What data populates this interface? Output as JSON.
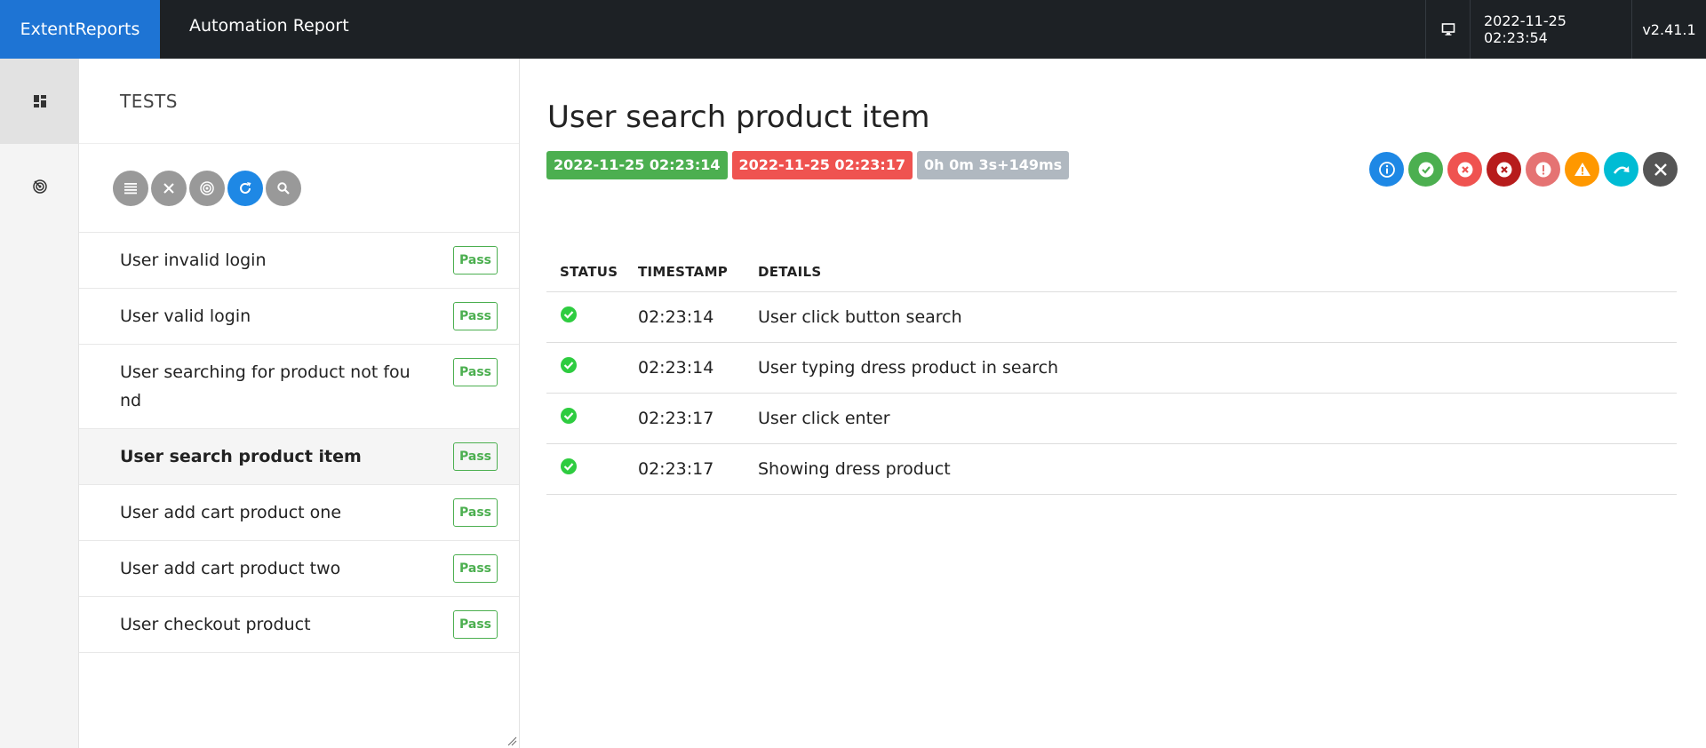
{
  "header": {
    "brand": "ExtentReports",
    "title": "Automation Report",
    "datetime": "2022-11-25 02:23:54",
    "version": "v2.41.1"
  },
  "colors": {
    "brand_blue": "#1e74d4",
    "topbar": "#1d2125",
    "pass_green": "#4caf50",
    "fail_red": "#ef5350",
    "duration_gray": "#b0b8c0"
  },
  "rail": {
    "items": [
      {
        "icon": "dashboard-icon",
        "active": true
      },
      {
        "icon": "radar-icon",
        "active": false
      }
    ]
  },
  "tests_panel": {
    "heading": "TESTS",
    "toolbar": [
      "list-icon",
      "close-icon",
      "radar-icon",
      "refresh-icon",
      "search-icon"
    ],
    "items": [
      {
        "name": "User invalid login",
        "status": "Pass"
      },
      {
        "name": "User valid login",
        "status": "Pass"
      },
      {
        "name": "User searching for product not found",
        "status": "Pass"
      },
      {
        "name": "User search product item",
        "status": "Pass"
      },
      {
        "name": "User add cart product one",
        "status": "Pass"
      },
      {
        "name": "User add cart product two",
        "status": "Pass"
      },
      {
        "name": "User checkout product",
        "status": "Pass"
      }
    ]
  },
  "detail": {
    "title": "User search product item",
    "start_time": "2022-11-25 02:23:14",
    "end_time": "2022-11-25 02:23:17",
    "duration": "0h 0m 3s+149ms",
    "status_filters": [
      "info-icon",
      "pass-icon",
      "fail-icon",
      "fatal-icon",
      "error-icon",
      "warning-icon",
      "skip-icon",
      "clear-icon"
    ],
    "columns": [
      "STATUS",
      "TIMESTAMP",
      "DETAILS"
    ],
    "steps": [
      {
        "status": "pass",
        "timestamp": "02:23:14",
        "details": "User click button search"
      },
      {
        "status": "pass",
        "timestamp": "02:23:14",
        "details": "User typing dress product in search"
      },
      {
        "status": "pass",
        "timestamp": "02:23:17",
        "details": "User click enter"
      },
      {
        "status": "pass",
        "timestamp": "02:23:17",
        "details": "Showing dress product"
      }
    ]
  }
}
